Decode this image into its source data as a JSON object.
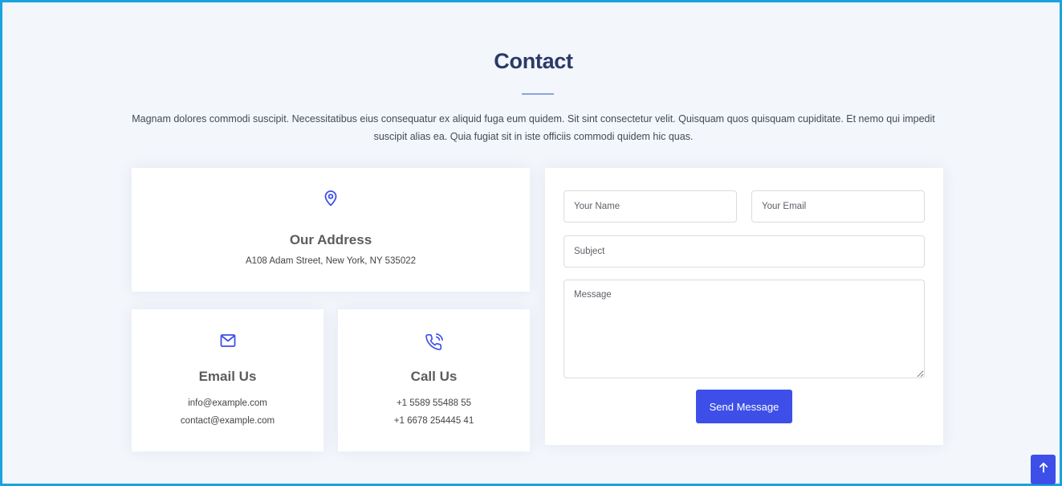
{
  "section": {
    "title": "Contact",
    "description": "Magnam dolores commodi suscipit. Necessitatibus eius consequatur ex aliquid fuga eum quidem. Sit sint consectetur velit. Quisquam quos quisquam cupiditate. Et nemo qui impedit suscipit alias ea. Quia fugiat sit in iste officiis commodi quidem hic quas."
  },
  "address_card": {
    "icon": "map-pin-icon",
    "heading": "Our Address",
    "text": "A108 Adam Street, New York, NY 535022"
  },
  "email_card": {
    "icon": "envelope-icon",
    "heading": "Email Us",
    "lines": [
      "info@example.com",
      "contact@example.com"
    ]
  },
  "call_card": {
    "icon": "phone-call-icon",
    "heading": "Call Us",
    "lines": [
      "+1 5589 55488 55",
      "+1 6678 254445 41"
    ]
  },
  "form": {
    "name_placeholder": "Your Name",
    "email_placeholder": "Your Email",
    "subject_placeholder": "Subject",
    "message_placeholder": "Message",
    "submit_label": "Send Message"
  },
  "back_to_top": {
    "icon": "arrow-up-icon"
  },
  "colors": {
    "accent": "#3d4fe8",
    "heading": "#2b3a67",
    "frame_border": "#1aa3de",
    "background": "#f3f6fb"
  }
}
